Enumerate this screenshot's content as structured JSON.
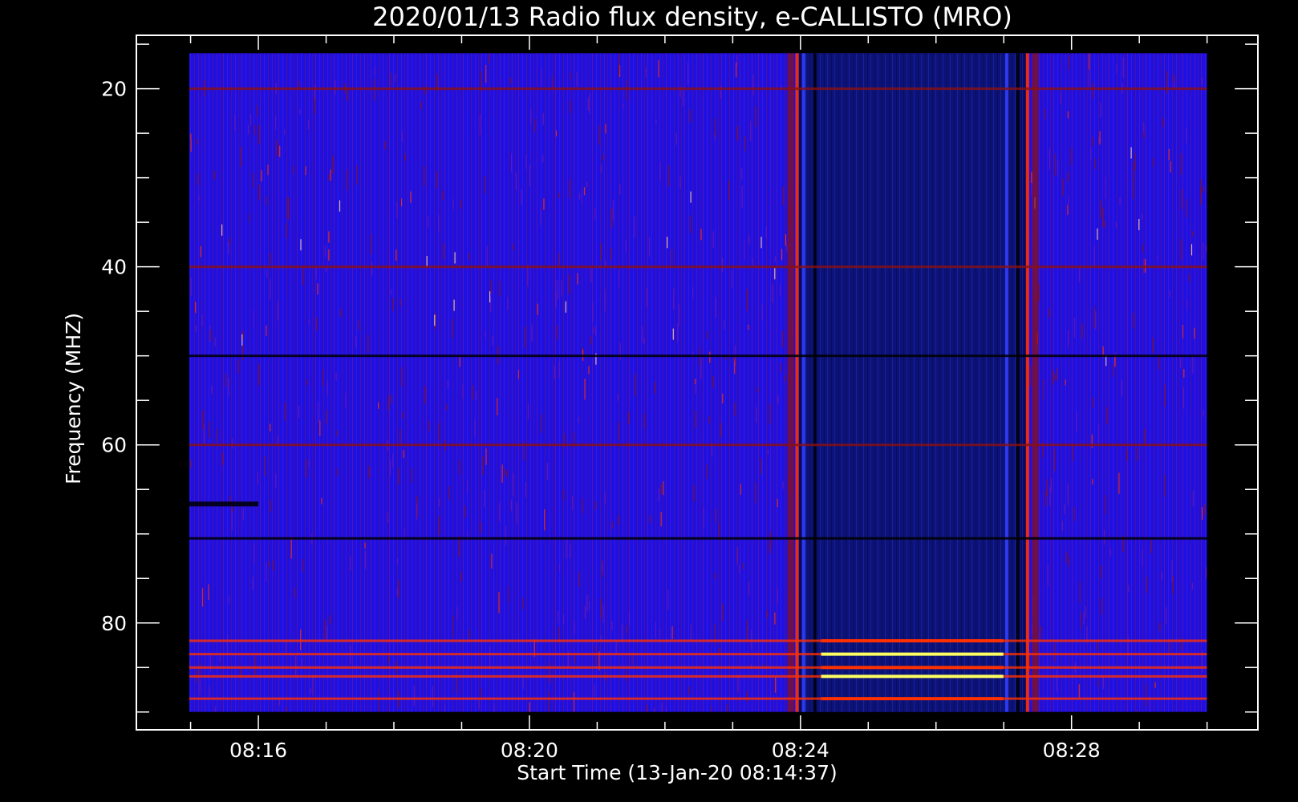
{
  "chart_data": {
    "type": "heatmap",
    "title": "2020/01/13  Radio flux density, e-CALLISTO (MRO)",
    "xlabel": "Start Time (13-Jan-20 08:14:37)",
    "ylabel": "Frequency (MHZ)",
    "x_ticks": [
      "08:16",
      "08:20",
      "08:24",
      "08:28"
    ],
    "x_tick_minutes": [
      16,
      20,
      24,
      28
    ],
    "x_minor_minutes": [
      15,
      17,
      18,
      19,
      21,
      22,
      23,
      25,
      26,
      27,
      29,
      30
    ],
    "x_range_minutes": [
      14.2,
      30.75
    ],
    "data_x_range_minutes": [
      14.98,
      30.0
    ],
    "y_ticks": [
      "20",
      "40",
      "60",
      "80"
    ],
    "y_tick_values": [
      20,
      40,
      60,
      80
    ],
    "y_minor_values": [
      15,
      25,
      30,
      35,
      45,
      50,
      55,
      65,
      70,
      75,
      85,
      90
    ],
    "y_range": [
      14,
      92
    ],
    "data_y_range": [
      16,
      90
    ],
    "y_inverted": true,
    "colormap": [
      "#000000",
      "#1a00ff",
      "#8b1010",
      "#ff3000",
      "#ffff60"
    ],
    "background_color": "#2010e0",
    "features": {
      "interference_block_minutes": [
        23.95,
        27.35
      ],
      "horizontal_lines_mhz": [
        20,
        40,
        50,
        60,
        66.5,
        70.5,
        82,
        83.5,
        85,
        86,
        88.5
      ]
    }
  }
}
